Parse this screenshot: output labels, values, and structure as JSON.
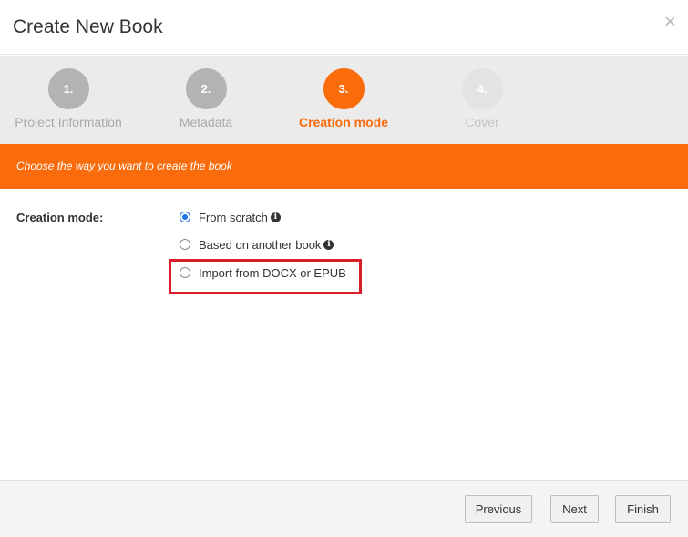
{
  "dialog": {
    "title": "Create New Book",
    "close_symbol": "×"
  },
  "steps": [
    {
      "number": "1.",
      "label": "Project Information",
      "state": "done"
    },
    {
      "number": "2.",
      "label": "Metadata",
      "state": "done"
    },
    {
      "number": "3.",
      "label": "Creation mode",
      "state": "active"
    },
    {
      "number": "4.",
      "label": "Cover",
      "state": "future"
    }
  ],
  "banner": {
    "text": "Choose the way you want to create the book"
  },
  "form": {
    "label": "Creation mode:",
    "options": [
      {
        "label": "From scratch",
        "checked": true,
        "info": true
      },
      {
        "label": "Based on another book",
        "checked": false,
        "info": true
      },
      {
        "label": "Import from DOCX or EPUB",
        "checked": false,
        "info": false
      }
    ],
    "info_glyph": "i"
  },
  "footer": {
    "previous_label": "Previous",
    "next_label": "Next",
    "finish_label": "Finish"
  },
  "colors": {
    "accent": "#fa6b0c",
    "highlight": "#d81e2a",
    "radio_checked": "#1a73e8"
  }
}
